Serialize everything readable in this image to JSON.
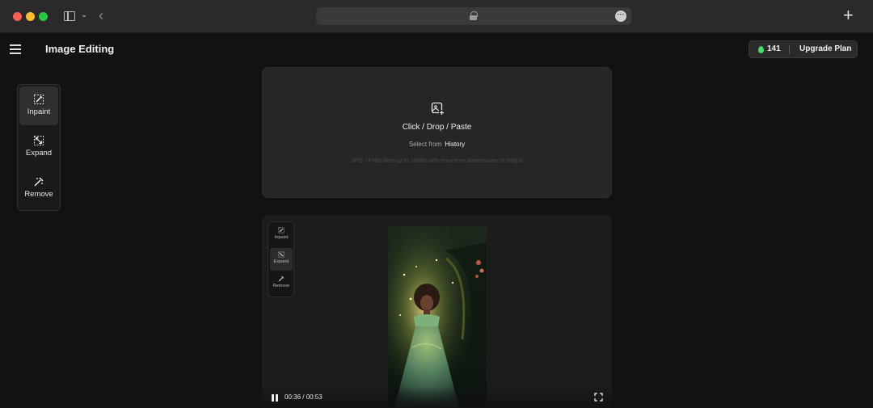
{
  "browser": {
    "icons": [
      "sidebar-toggle-icon",
      "chevron-down-icon",
      "back-arrow-icon",
      "lock-icon",
      "more-icon",
      "plus-icon"
    ],
    "new_tab": "+"
  },
  "header": {
    "title": "Image Editing",
    "credits": "141",
    "upgrade_label": "Upgrade Plan",
    "credit_icon_color": "#4cd964"
  },
  "tools": [
    {
      "label": "Inpaint",
      "icon": "inpaint-icon",
      "active": true
    },
    {
      "label": "Expand",
      "icon": "expand-icon",
      "active": false
    },
    {
      "label": "Remove",
      "icon": "remove-icon",
      "active": false
    }
  ],
  "upload": {
    "icon": "image-add-icon",
    "main_text": "Click / Drop / Paste",
    "select_prefix": "Select from",
    "history_label": "History",
    "hint": "JPG / PNG files up to 10MB with minimum dimensions of 300px"
  },
  "video": {
    "mini_tools": [
      {
        "label": "Inpaint",
        "active": false
      },
      {
        "label": "Expand",
        "active": true
      },
      {
        "label": "Remove",
        "active": false
      }
    ],
    "time": "00:36 / 00:53",
    "playing": true
  }
}
